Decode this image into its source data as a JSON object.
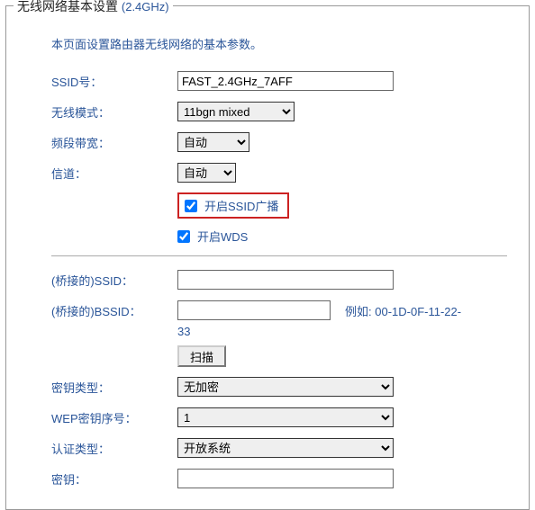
{
  "legend": {
    "title": "无线网络基本设置",
    "band": "(2.4GHz)"
  },
  "intro": "本页面设置路由器无线网络的基本参数。",
  "labels": {
    "ssid": "SSID号：",
    "mode": "无线模式：",
    "bandwidth": "频段带宽：",
    "channel": "信道：",
    "broadcast": "开启SSID广播",
    "wds": "开启WDS",
    "bridge_ssid": "(桥接的)SSID：",
    "bridge_bssid": "(桥接的)BSSID：",
    "example_prefix": "例如:",
    "example_val": "00-1D-0F-11-22-33",
    "scan": "扫描",
    "key_type": "密钥类型：",
    "wep_index": "WEP密钥序号：",
    "auth_type": "认证类型：",
    "key": "密钥："
  },
  "values": {
    "ssid": "FAST_2.4GHz_7AFF",
    "mode": "11bgn mixed",
    "bandwidth": "自动",
    "channel": "自动",
    "broadcast_checked": true,
    "wds_checked": true,
    "bridge_ssid": "",
    "bridge_bssid": "",
    "key_type": "无加密",
    "wep_index": "1",
    "auth_type": "开放系统",
    "key": ""
  }
}
